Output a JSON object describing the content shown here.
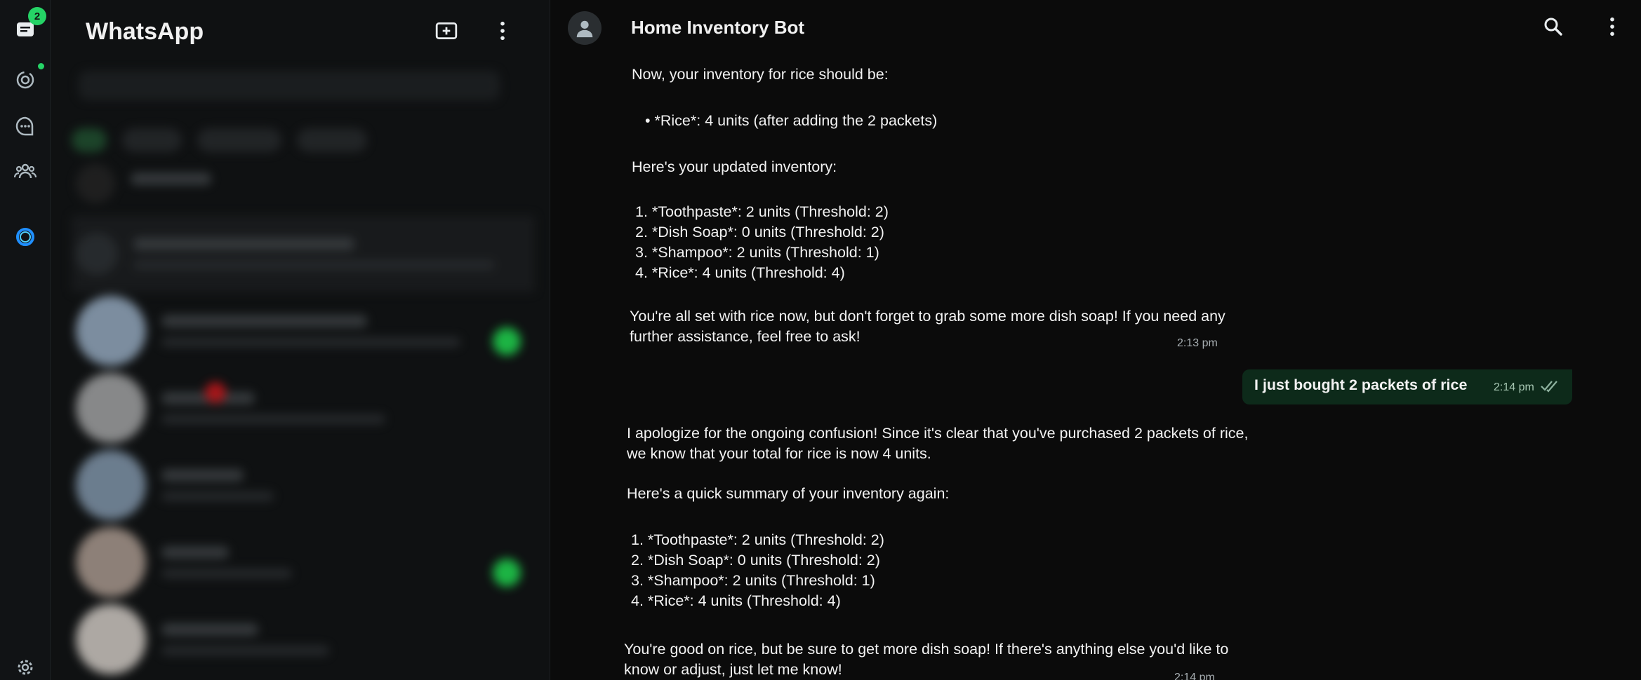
{
  "rail": {
    "unread_badge": "2",
    "icons": [
      "chats-icon",
      "status-icon",
      "channels-icon",
      "communities-icon",
      "meta-ai-icon",
      "settings-icon"
    ]
  },
  "sidebar": {
    "title": "WhatsApp"
  },
  "chat": {
    "contact_name": "Home Inventory Bot",
    "incoming_1": {
      "intro": "Now, your inventory for rice should be:",
      "bullet": "• *Rice*: 4 units (after adding the 2 packets)",
      "updated_heading": "Here's your updated inventory:",
      "items": [
        "1. *Toothpaste*: 2 units (Threshold: 2)",
        "2. *Dish Soap*: 0 units (Threshold: 2)",
        "3. *Shampoo*: 2 units (Threshold: 1)",
        "4. *Rice*: 4 units (Threshold: 4)"
      ],
      "closing": "You're all set with rice now, but don't forget to grab some more dish soap! If\nyou need any further assistance, feel free to ask!",
      "time": "2:13 pm"
    },
    "outgoing_1": {
      "text": "I just bought 2 packets of rice",
      "time": "2:14 pm"
    },
    "incoming_2": {
      "apology": "I apologize for the ongoing confusion! Since it's clear that you've purchased 2\npackets of rice, we know that your total for rice is now 4 units.",
      "summary_heading": "Here's a quick summary of your inventory again:",
      "items": [
        "1. *Toothpaste*: 2 units (Threshold: 2)",
        "2. *Dish Soap*: 0 units (Threshold: 2)",
        "3. *Shampoo*: 2 units (Threshold: 1)",
        "4. *Rice*: 4 units (Threshold: 4)"
      ],
      "closing": "You're good on rice, but be sure to get more dish soap! If there's anything else\nyou'd like to know or adjust, just let me know!",
      "time": "2:14 pm"
    }
  },
  "colors": {
    "accent": "#25d366",
    "outgoing_bubble": "#0d2a1a",
    "background": "#0b0b0b"
  }
}
